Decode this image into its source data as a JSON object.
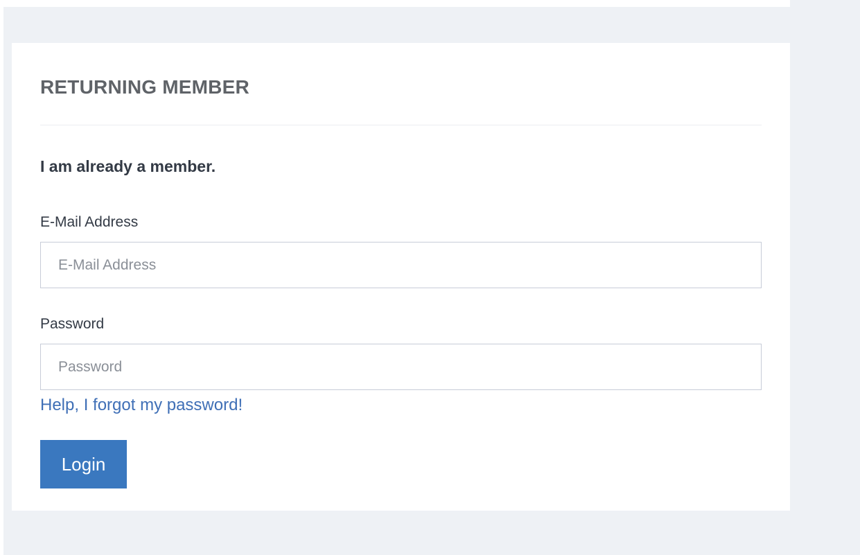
{
  "login_card": {
    "title": "RETURNING MEMBER",
    "subtitle": "I am already a member.",
    "email": {
      "label": "E-Mail Address",
      "value": "",
      "placeholder": "E-Mail Address"
    },
    "password": {
      "label": "Password",
      "value": "",
      "placeholder": "Password"
    },
    "forgot_link": "Help, I forgot my password!",
    "login_button": "Login"
  },
  "colors": {
    "page_background": "#eef1f5",
    "card_background": "#ffffff",
    "title_text": "#5f6368",
    "body_text": "#333a45",
    "link": "#3f6fb6",
    "button_background": "#3a78bf",
    "button_text": "#ffffff",
    "input_border": "#c7ccd8"
  }
}
